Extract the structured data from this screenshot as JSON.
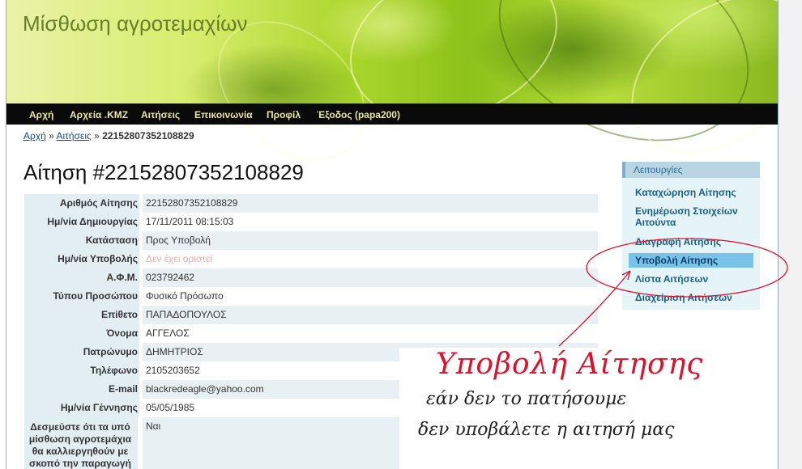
{
  "site": {
    "title": "Μίσθωση αγροτεμαχίων"
  },
  "nav": {
    "items": [
      "Αρχή",
      "Αρχεία .KMZ",
      "Αιτήσεις",
      "Επικοινωνία",
      "Προφίλ",
      "Έξοδος (papa200)"
    ]
  },
  "breadcrumb": {
    "home": "Αρχή",
    "sep1": "»",
    "section": "Αιτήσεις",
    "sep2": "»",
    "current": "22152807352108829"
  },
  "page": {
    "title": "Αίτηση #22152807352108829"
  },
  "details": [
    {
      "label": "Αριθμός Αίτησης",
      "value": "22152807352108829"
    },
    {
      "label": "Ημ/νία Δημιουργίας",
      "value": "17/11/2011 08:15:03"
    },
    {
      "label": "Κατάσταση",
      "value": "Προς Υποβολή"
    },
    {
      "label": "Ημ/νία Υποβολής",
      "value": "Δεν έχει οριστεί"
    },
    {
      "label": "Α.Φ.Μ.",
      "value": "023792462"
    },
    {
      "label": "Τύπου Προσώπου",
      "value": "Φυσικό Πρόσωπο"
    },
    {
      "label": "Επίθετο",
      "value": "ΠΑΠΑΔΟΠΟΥΛΟΣ"
    },
    {
      "label": "Όνομα",
      "value": "ΑΓΓΕΛΟΣ"
    },
    {
      "label": "Πατρώνυμο",
      "value": "ΔΗΜΗΤΡΙΟΣ"
    },
    {
      "label": "Τηλέφωνο",
      "value": "2105203652"
    },
    {
      "label": "E-mail",
      "value": "blackredeagle@yahoo.com"
    },
    {
      "label": "Ημ/νία Γέννησης",
      "value": "05/05/1985"
    },
    {
      "label": "Δεσμεύστε ότι τα υπό μίσθωση αγροτεμάχια θα καλλιεργηθούν με σκοπό την παραγωγή",
      "value": "Ναι"
    }
  ],
  "sidebar": {
    "title": "Λειτουργίες",
    "items": [
      "Καταχώρηση Αίτησης",
      "Ενημέρωση Στοιχείων Αιτούντα",
      "Διαγραφή Αίτησης",
      "Υποβολή Αίτησης",
      "Λίστα Αιτήσεων",
      "Διαχείριση Αιτήσεων"
    ]
  },
  "annotation": {
    "title": "Υποβολή Αίτησης",
    "line1": "εάν δεν το πατήσουμε",
    "line2": "δεν υποβάλετε η αιτησή μας",
    "color": "#e0102a"
  },
  "colors": {
    "navbar": "#0a0a0a",
    "nav_text": "#e8e6a0",
    "label_bg": "#e3eef3",
    "link": "#1b5d8a",
    "placeholder_red": "#f0a8a8"
  }
}
